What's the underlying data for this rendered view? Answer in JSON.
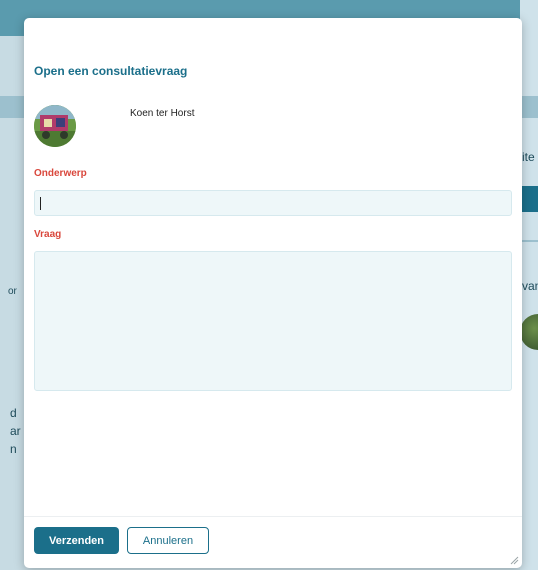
{
  "dialog": {
    "title": "Open een consultatievraag",
    "user_name": "Koen ter Horst",
    "subject_label": "Onderwerp",
    "subject_value": "",
    "question_label": "Vraag",
    "question_value": "",
    "submit_label": "Verzenden",
    "cancel_label": "Annuleren"
  },
  "background": {
    "fragments": [
      "ite",
      "van",
      "or",
      "d",
      "ar",
      "n"
    ]
  },
  "colors": {
    "accent": "#1b6f8a",
    "label_red": "#d9473c",
    "field_bg": "#eef7f9"
  },
  "icons": [
    "avatar-photo",
    "resize-handle-icon"
  ]
}
